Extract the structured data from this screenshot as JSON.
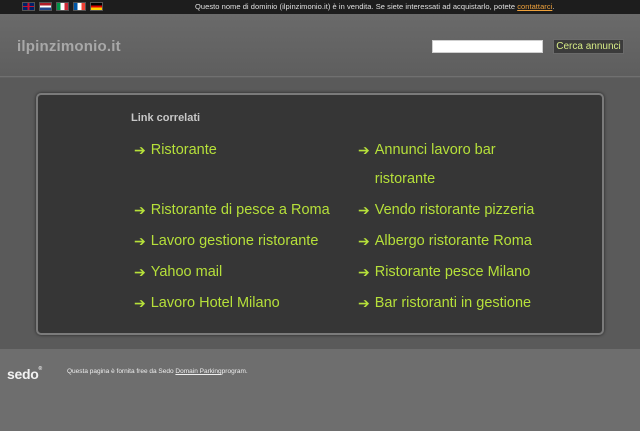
{
  "topbar": {
    "flags": [
      "uk-flag",
      "nl-flag",
      "it-flag",
      "fr-flag",
      "de-flag"
    ],
    "notice_text": "Questo nome di dominio (ilpinzimonio.it) è in vendita. Se siete interessati ad acquistarlo, potete ",
    "notice_link": "contattarci",
    "notice_end": "."
  },
  "header": {
    "site_title": "ilpinzimonio.it",
    "search_value": "",
    "search_button": "Cerca annunci"
  },
  "panel": {
    "title": "Link correlati",
    "arrow": "➔",
    "links": [
      {
        "label": "Ristorante"
      },
      {
        "label": "Annunci lavoro bar ristorante"
      },
      {
        "label": "Ristorante di pesce a Roma"
      },
      {
        "label": "Vendo ristorante pizzeria"
      },
      {
        "label": "Lavoro gestione ristorante"
      },
      {
        "label": "Albergo ristorante Roma"
      },
      {
        "label": "Yahoo mail"
      },
      {
        "label": "Ristorante pesce Milano"
      },
      {
        "label": "Lavoro Hotel Milano"
      },
      {
        "label": "Bar ristoranti in gestione"
      }
    ]
  },
  "footer": {
    "logo": "sedo",
    "text_before": "Questa pagina è fornita free da Sedo ",
    "text_link": "Domain Parking",
    "text_after": "program."
  },
  "colors": {
    "link": "#b6e03a",
    "notice_link": "#f0a23c",
    "background": "#616161"
  }
}
